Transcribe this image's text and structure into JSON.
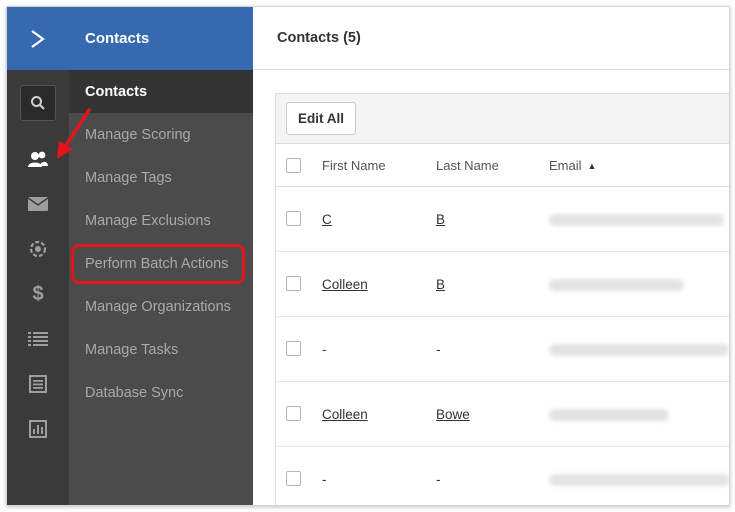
{
  "menu": {
    "header": "Contacts",
    "items": [
      {
        "label": "Contacts"
      },
      {
        "label": "Manage Scoring"
      },
      {
        "label": "Manage Tags"
      },
      {
        "label": "Manage Exclusions"
      },
      {
        "label": "Perform Batch Actions"
      },
      {
        "label": "Manage Organizations"
      },
      {
        "label": "Manage Tasks"
      },
      {
        "label": "Database Sync"
      }
    ]
  },
  "rail": {
    "icons": [
      "logo-chevron-icon",
      "search-icon",
      "contacts-icon",
      "email-icon",
      "automation-icon",
      "dollar-icon",
      "list-icon",
      "forms-icon",
      "reports-icon"
    ]
  },
  "main": {
    "title": "Contacts (5)",
    "edit_all_label": "Edit All",
    "columns": [
      "First Name",
      "Last Name",
      "Email"
    ],
    "sort_indicator": "▲",
    "rows": [
      {
        "first": "C",
        "last": "B"
      },
      {
        "first": "Colleen",
        "last": "B"
      },
      {
        "first": "-",
        "last": "-"
      },
      {
        "first": "Colleen",
        "last": "Bowe"
      },
      {
        "first": "-",
        "last": "-"
      }
    ]
  },
  "colors": {
    "brand_blue": "#356ab0",
    "rail_bg": "#3a3a3a",
    "menu_bg": "#4b4b4b",
    "annotation_red": "#e3151a"
  }
}
